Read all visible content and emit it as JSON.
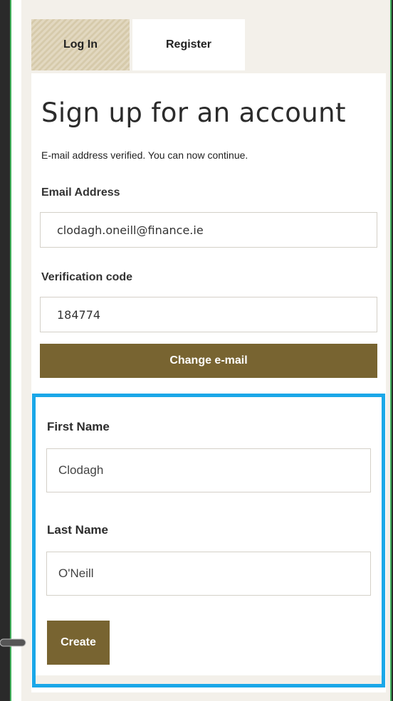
{
  "tabs": {
    "login": "Log In",
    "register": "Register"
  },
  "page_title": "Sign up for an account",
  "notice": "E-mail address verified. You can now continue.",
  "email": {
    "label": "Email Address",
    "value": "clodagh.oneill@finance.ie"
  },
  "verification": {
    "label": "Verification code",
    "value": "184774"
  },
  "change_email_button": "Change e-mail",
  "first_name": {
    "label": "First Name",
    "value": "Clodagh"
  },
  "last_name": {
    "label": "Last Name",
    "value": "O'Neill"
  },
  "create_button": "Create",
  "colors": {
    "accent": "#786431",
    "highlight": "#1aa7e8",
    "frame": "#3fae5a"
  }
}
